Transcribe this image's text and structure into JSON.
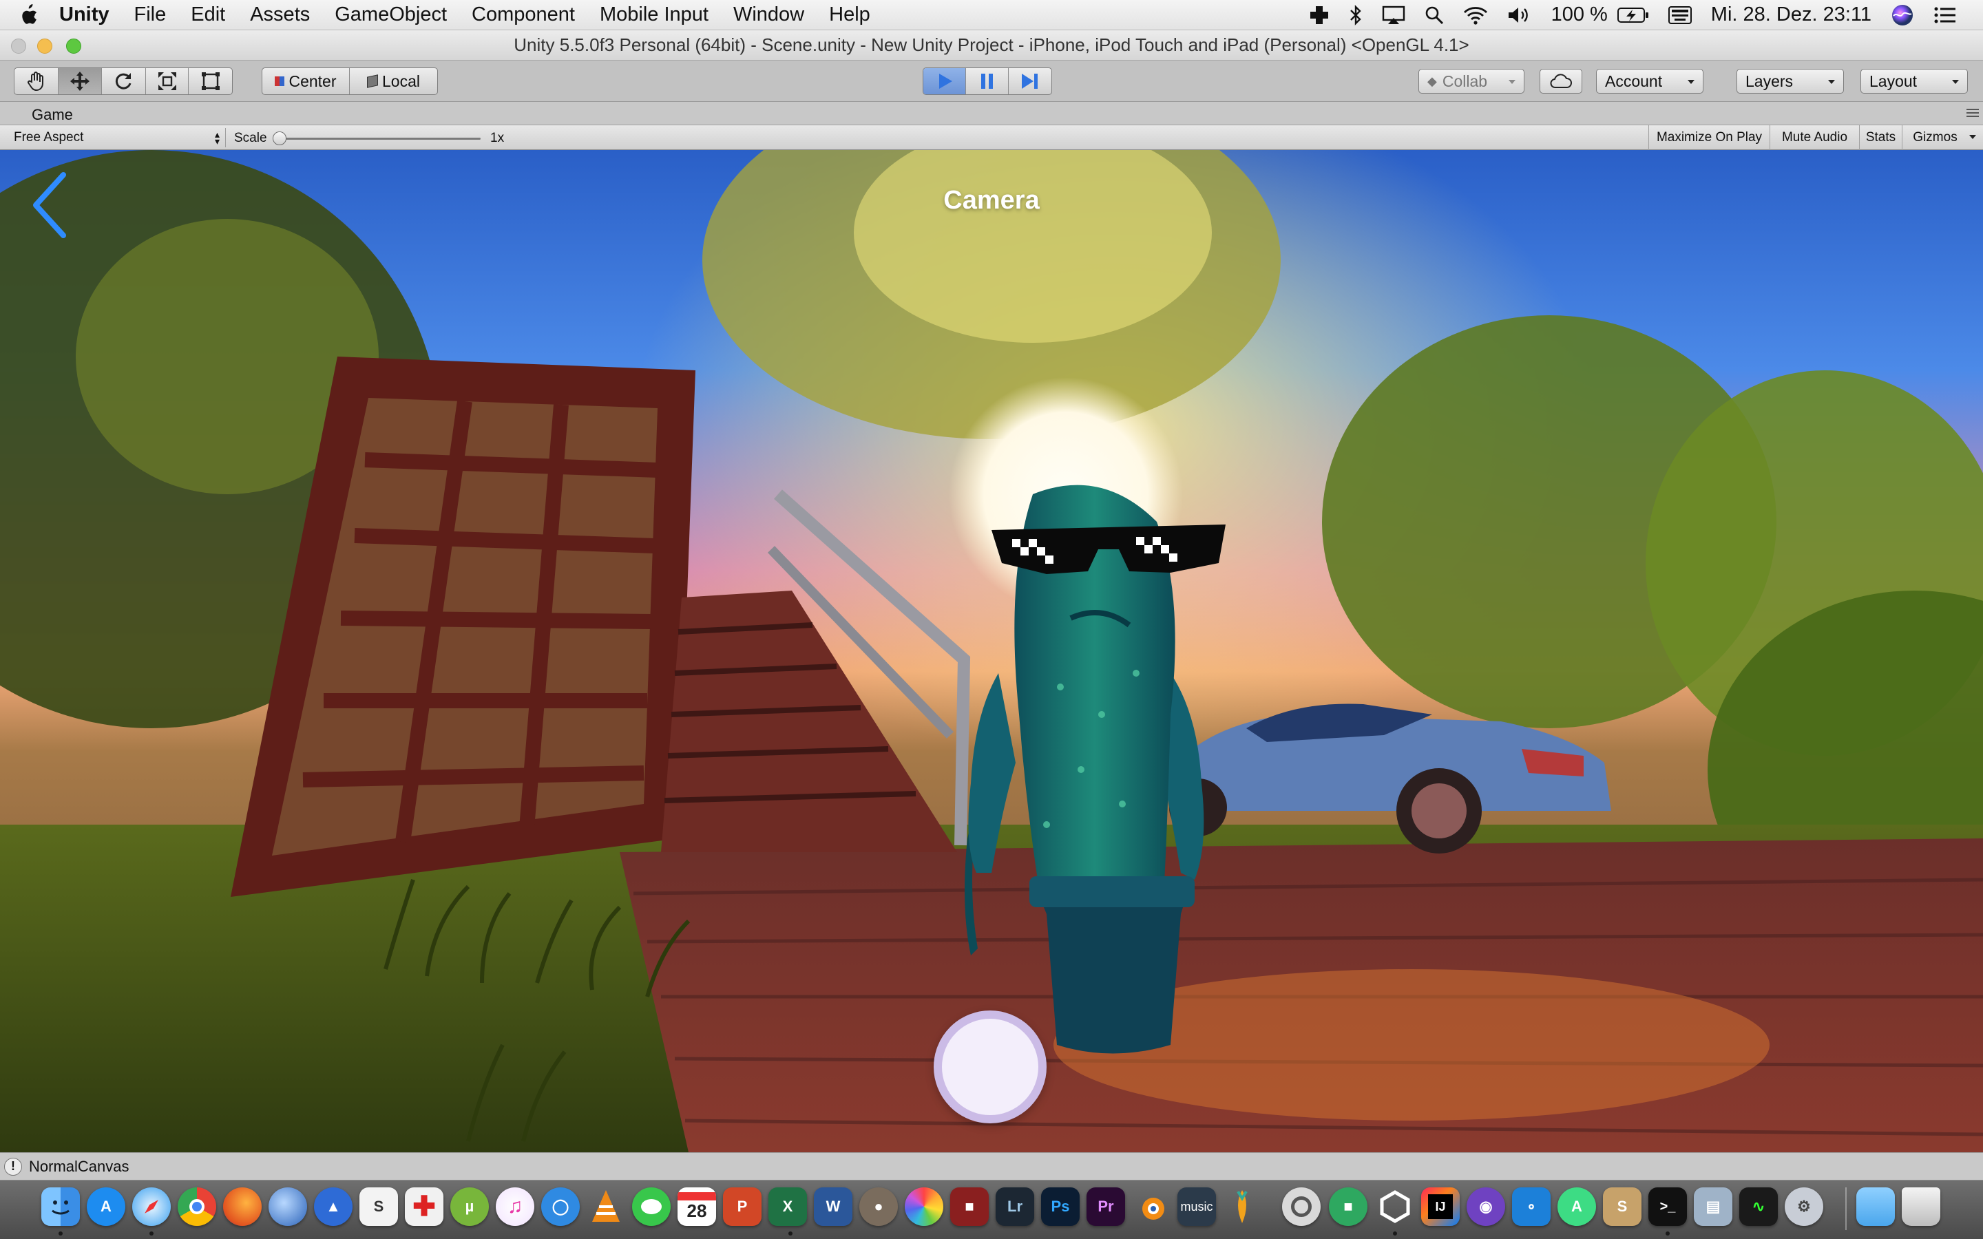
{
  "menubar": {
    "app_name": "Unity",
    "items": [
      "File",
      "Edit",
      "Assets",
      "GameObject",
      "Component",
      "Mobile Input",
      "Window",
      "Help"
    ],
    "battery": "100 %",
    "datetime": "Mi. 28. Dez. 23:11"
  },
  "window": {
    "title": "Unity 5.5.0f3 Personal (64bit) - Scene.unity - New Unity Project - iPhone, iPod Touch and iPad (Personal) <OpenGL 4.1>"
  },
  "toolbar": {
    "pivot_label": "Center",
    "space_label": "Local",
    "collab_label": "Collab",
    "account_label": "Account",
    "layers_label": "Layers",
    "layout_label": "Layout",
    "active_tool": "move-tool",
    "play_active": true
  },
  "game_panel": {
    "tab_label": "Game",
    "aspect": "Free Aspect",
    "scale_label": "Scale",
    "scale_value": "1x",
    "scale_level": 0,
    "toggles": [
      "Maximize On Play",
      "Mute Audio",
      "Stats",
      "Gizmos"
    ]
  },
  "game_view": {
    "screen_title": "Camera"
  },
  "status": {
    "message": "NormalCanvas"
  },
  "dock": {
    "apps": [
      "Finder",
      "App Store",
      "Safari",
      "Chrome",
      "Firefox",
      "Thunderbird",
      "Launchpad",
      "Sublime S",
      "Plus",
      "uTorrent",
      "iTunes",
      "Flow",
      "VLC",
      "Messages",
      "Calendar",
      "PowerPoint",
      "Excel",
      "Word",
      "Gimp",
      "Photos",
      "Photo Booth",
      "Lightroom",
      "Photoshop",
      "Premiere",
      "Blender",
      "Amazon Music",
      "Frenzy",
      "Preview",
      "Activity",
      "Unity",
      "IntelliJ",
      "GitHub",
      "Xcode",
      "Android Studio",
      "Slides",
      "Terminal",
      "Network",
      "Activity Monitor",
      "Utility",
      "Folder",
      "Trash"
    ],
    "labels": {
      "calendar_day": "28",
      "lightroom": "Lr",
      "photoshop": "Ps",
      "premiere": "Pr",
      "music": "music"
    }
  },
  "colors": {
    "play_blue": "#2f73e0",
    "camera_chevron": "#2f8cff",
    "shutter_fill": "#f3eefb",
    "shutter_ring": "#cbbbe6"
  }
}
